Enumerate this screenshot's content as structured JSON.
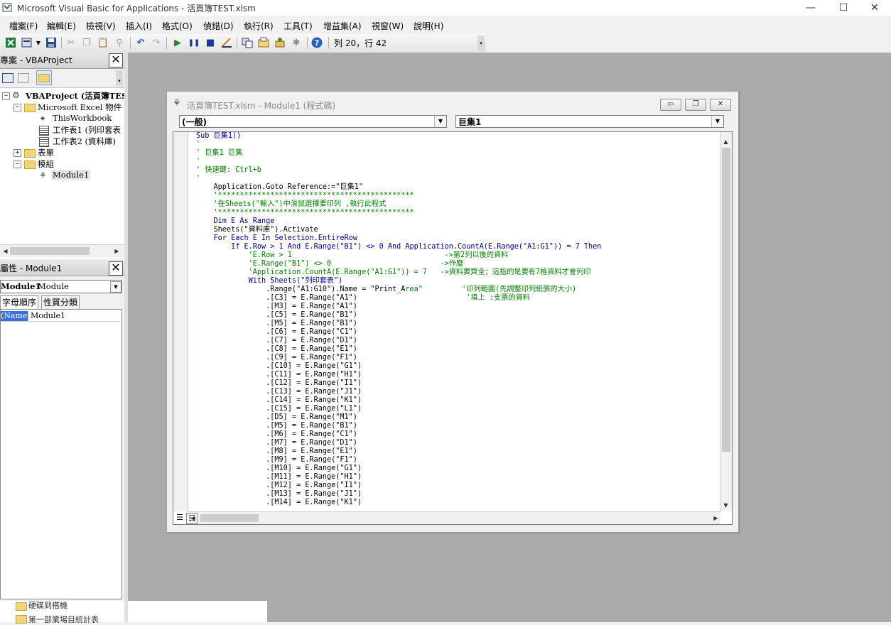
{
  "window": {
    "title": "Microsoft Visual Basic for Applications - 活頁簿TEST.xlsm",
    "controls": {
      "minimize": "—",
      "maximize": "☐",
      "close": "✕"
    }
  },
  "menu": [
    "檔案(F)",
    "編輯(E)",
    "檢視(V)",
    "插入(I)",
    "格式(O)",
    "偵錯(D)",
    "執行(R)",
    "工具(T)",
    "增益集(A)",
    "視窗(W)",
    "說明(H)"
  ],
  "toolbar": {
    "position_text": "列 20，行 42",
    "icons": [
      "excel-view-icon",
      "insert-module-icon",
      "save-icon",
      "cut-icon",
      "copy-icon",
      "paste-icon",
      "find-icon",
      "undo-icon",
      "redo-icon",
      "run-icon",
      "break-icon",
      "reset-icon",
      "design-mode-icon",
      "project-explorer-icon",
      "properties-icon",
      "object-browser-icon",
      "toolbox-icon",
      "help-icon"
    ]
  },
  "project_pane": {
    "title": "專案 - VBAProject",
    "root": "VBAProject (活頁簿TES",
    "excel_objects": "Microsoft Excel 物件",
    "this_workbook": "ThisWorkbook",
    "sheet1": "工作表1 (列印套表",
    "sheet2": "工作表2 (資料庫)",
    "forms": "表單",
    "modules": "模組",
    "module1": "Module1"
  },
  "properties_pane": {
    "title": "屬性 - Module1",
    "object_name": "Module1",
    "object_type": "Module",
    "tab_alpha": "字母順序",
    "tab_category": "性質分類",
    "prop_name": "(Name)",
    "prop_value": "Module1"
  },
  "code_window": {
    "title": "活頁簿TEST.xlsm - Module1 (程式碼)",
    "object_combo": "(一般)",
    "proc_combo": "巨集1"
  },
  "background_items": [
    "硬碟到搭機",
    "第一部業場目統計表"
  ],
  "code_lines": [
    {
      "t": "Sub 巨集1()",
      "c": "kw"
    },
    {
      "t": "'",
      "c": "cm"
    },
    {
      "t": "' 巨集1 巨集",
      "c": "cm"
    },
    {
      "t": "'",
      "c": "cm"
    },
    {
      "t": "' 快速鍵: Ctrl+b",
      "c": "cm"
    },
    {
      "t": "'",
      "c": "cm"
    },
    {
      "t": "    Application.Goto Reference:=\"巨集1\"",
      "c": ""
    },
    {
      "t": "    '*********************************************",
      "c": "cm"
    },
    {
      "t": "    '在Sheets(\"輸入\")中滑鼠選擇要印列 ,執行此程式",
      "c": "cm"
    },
    {
      "t": "    '*********************************************",
      "c": "cm"
    },
    {
      "t": "    Dim E As Range",
      "c": "kw"
    },
    {
      "t": "    Sheets(\"資料庫\").Activate",
      "c": ""
    },
    {
      "t": "    For Each E In Selection.EntireRow",
      "c": "kw"
    },
    {
      "t": "        If E.Row > 1 And E.Range(\"B1\") <> 0 And Application.CountA(E.Range(\"A1:G1\")) = 7 Then",
      "c": "kw"
    },
    {
      "t": "            'E.Row > 1                                   ->第2列以後的資料",
      "c": "cm"
    },
    {
      "t": "            'E.Range(\"B1\") <> 0                         ->作廢",
      "c": "cm"
    },
    {
      "t": "            'Application.CountA(E.Range(\"A1:G1\")) = 7   ->資料要齊全；這指的是要有7格資料才會列印",
      "c": "cm"
    },
    {
      "t": "            With Sheets(\"列印套表\")",
      "c": "kw"
    },
    {
      "t": "                .Range(\"A1:G10\").Name = \"Print_Area\"         '印列範圍(先調整印列紙張的大小)",
      "c": "mix",
      "split": 48
    },
    {
      "t": "                .[C3] = E.Range(\"A1\")                         '填上 :支票的資料",
      "c": "mix",
      "split": 48
    },
    {
      "t": "                .[M3] = E.Range(\"A1\")",
      "c": ""
    },
    {
      "t": "                .[C5] = E.Range(\"B1\")",
      "c": ""
    },
    {
      "t": "                .[M5] = E.Range(\"B1\")",
      "c": ""
    },
    {
      "t": "                .[C6] = E.Range(\"C1\")",
      "c": ""
    },
    {
      "t": "                .[C7] = E.Range(\"D1\")",
      "c": ""
    },
    {
      "t": "                .[C8] = E.Range(\"E1\")",
      "c": ""
    },
    {
      "t": "                .[C9] = E.Range(\"F1\")",
      "c": ""
    },
    {
      "t": "                .[C10] = E.Range(\"G1\")",
      "c": ""
    },
    {
      "t": "                .[C11] = E.Range(\"H1\")",
      "c": ""
    },
    {
      "t": "                .[C12] = E.Range(\"I1\")",
      "c": ""
    },
    {
      "t": "                .[C13] = E.Range(\"J1\")",
      "c": ""
    },
    {
      "t": "                .[C14] = E.Range(\"K1\")",
      "c": ""
    },
    {
      "t": "                .[C15] = E.Range(\"L1\")",
      "c": ""
    },
    {
      "t": "                .[D5] = E.Range(\"M1\")",
      "c": ""
    },
    {
      "t": "                .[M5] = E.Range(\"B1\")",
      "c": ""
    },
    {
      "t": "                .[M6] = E.Range(\"C1\")",
      "c": ""
    },
    {
      "t": "                .[M7] = E.Range(\"D1\")",
      "c": ""
    },
    {
      "t": "                .[M8] = E.Range(\"E1\")",
      "c": ""
    },
    {
      "t": "                .[M9] = E.Range(\"F1\")",
      "c": ""
    },
    {
      "t": "                .[M10] = E.Range(\"G1\")",
      "c": ""
    },
    {
      "t": "                .[M11] = E.Range(\"H1\")",
      "c": ""
    },
    {
      "t": "                .[M12] = E.Range(\"I1\")",
      "c": ""
    },
    {
      "t": "                .[M13] = E.Range(\"J1\")",
      "c": ""
    },
    {
      "t": "                .[M14] = E.Range(\"K1\")",
      "c": ""
    }
  ]
}
